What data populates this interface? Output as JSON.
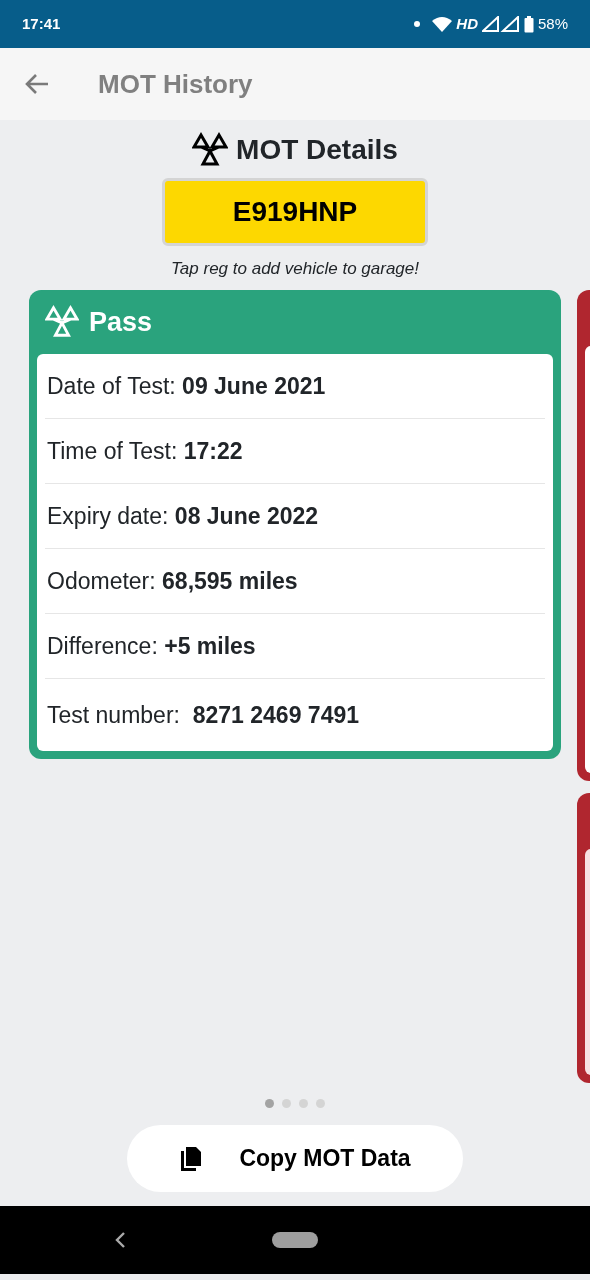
{
  "status_bar": {
    "time": "17:41",
    "network": "HD",
    "battery": "58%"
  },
  "app_bar": {
    "title": "MOT History"
  },
  "header": {
    "title": "MOT Details",
    "registration": "E919HNP",
    "hint": "Tap reg to add vehicle to garage!"
  },
  "tests": [
    {
      "color": "#2aa37d",
      "title": "Pass",
      "rows": [
        "Date of Test: **09 June 2021**",
        "Time of Test: **17:22**",
        "Expiry date: **08 June 2022**",
        "Odometer: **68,595 miles**",
        "Difference: **+5 miles**",
        "Test number:  **8271 2469 7491**"
      ]
    },
    {
      "color": "#b0262f"
    },
    {
      "color": "#b0262f"
    }
  ],
  "pager": [
    {
      "selected": true
    },
    {
      "selected": false
    },
    {
      "selected": false
    },
    {
      "selected": false
    }
  ],
  "copy_button": {
    "label": "Copy MOT Data"
  }
}
